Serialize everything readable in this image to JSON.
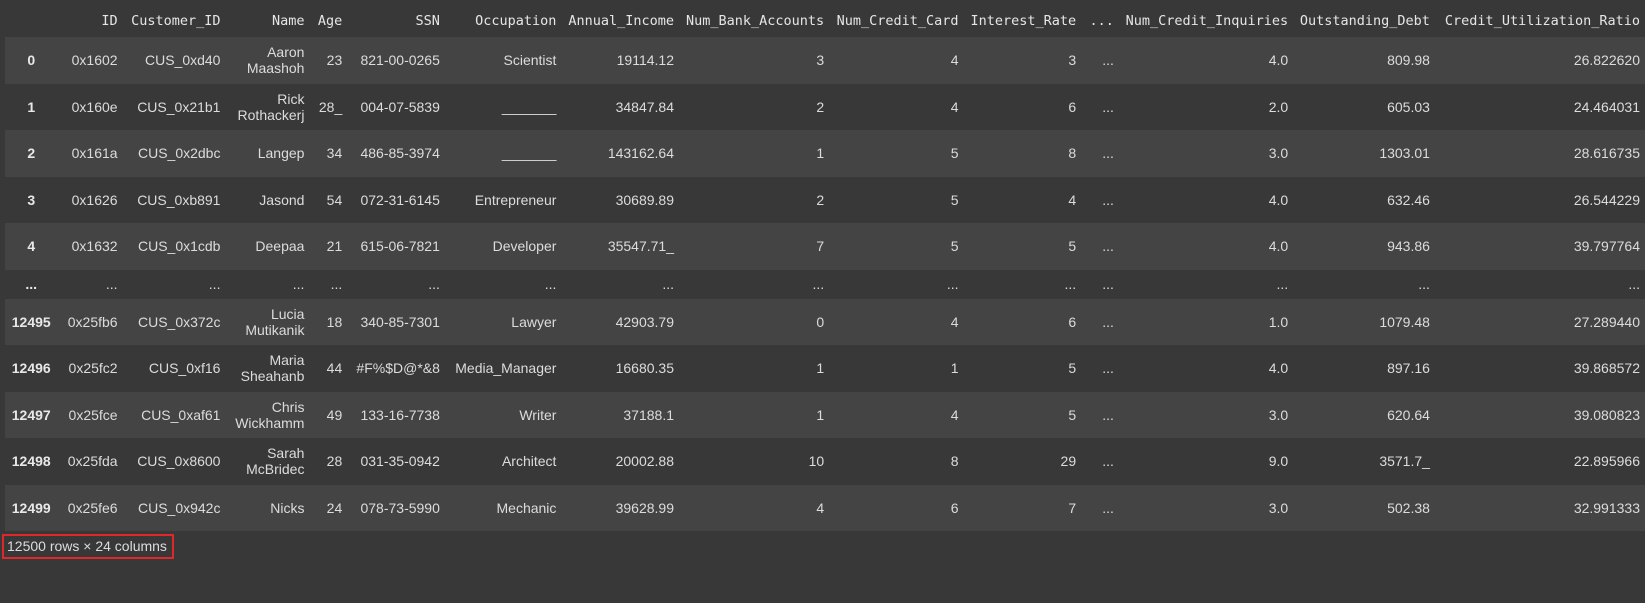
{
  "columns": [
    "",
    "ID",
    "Customer_ID",
    "Name",
    "Age",
    "SSN",
    "Occupation",
    "Annual_Income",
    "Num_Bank_Accounts",
    "Num_Credit_Card",
    "Interest_Rate",
    "...",
    "Num_Credit_Inquiries",
    "Outstanding_Debt",
    "Credit_Utilization_Ratio"
  ],
  "rows": [
    [
      "0",
      "0x1602",
      "CUS_0xd40",
      "Aaron Maashoh",
      "23",
      "821-00-0265",
      "Scientist",
      "19114.12",
      "3",
      "4",
      "3",
      "...",
      "4.0",
      "809.98",
      "26.822620"
    ],
    [
      "1",
      "0x160e",
      "CUS_0x21b1",
      "Rick Rothackerj",
      "28_",
      "004-07-5839",
      "_______",
      "34847.84",
      "2",
      "4",
      "6",
      "...",
      "2.0",
      "605.03",
      "24.464031"
    ],
    [
      "2",
      "0x161a",
      "CUS_0x2dbc",
      "Langep",
      "34",
      "486-85-3974",
      "_______",
      "143162.64",
      "1",
      "5",
      "8",
      "...",
      "3.0",
      "1303.01",
      "28.616735"
    ],
    [
      "3",
      "0x1626",
      "CUS_0xb891",
      "Jasond",
      "54",
      "072-31-6145",
      "Entrepreneur",
      "30689.89",
      "2",
      "5",
      "4",
      "...",
      "4.0",
      "632.46",
      "26.544229"
    ],
    [
      "4",
      "0x1632",
      "CUS_0x1cdb",
      "Deepaa",
      "21",
      "615-06-7821",
      "Developer",
      "35547.71_",
      "7",
      "5",
      "5",
      "...",
      "4.0",
      "943.86",
      "39.797764"
    ],
    [
      "...",
      "...",
      "...",
      "...",
      "...",
      "...",
      "...",
      "...",
      "...",
      "...",
      "...",
      "...",
      "...",
      "...",
      "..."
    ],
    [
      "12495",
      "0x25fb6",
      "CUS_0x372c",
      "Lucia Mutikanik",
      "18",
      "340-85-7301",
      "Lawyer",
      "42903.79",
      "0",
      "4",
      "6",
      "...",
      "1.0",
      "1079.48",
      "27.289440"
    ],
    [
      "12496",
      "0x25fc2",
      "CUS_0xf16",
      "Maria Sheahanb",
      "44",
      "#F%$D@*&8",
      "Media_Manager",
      "16680.35",
      "1",
      "1",
      "5",
      "...",
      "4.0",
      "897.16",
      "39.868572"
    ],
    [
      "12497",
      "0x25fce",
      "CUS_0xaf61",
      "Chris Wickhamm",
      "49",
      "133-16-7738",
      "Writer",
      "37188.1",
      "1",
      "4",
      "5",
      "...",
      "3.0",
      "620.64",
      "39.080823"
    ],
    [
      "12498",
      "0x25fda",
      "CUS_0x8600",
      "Sarah McBridec",
      "28",
      "031-35-0942",
      "Architect",
      "20002.88",
      "10",
      "8",
      "29",
      "...",
      "9.0",
      "3571.7_",
      "22.895966"
    ],
    [
      "12499",
      "0x25fe6",
      "CUS_0x942c",
      "Nicks",
      "24",
      "078-73-5990",
      "Mechanic",
      "39628.99",
      "4",
      "6",
      "7",
      "...",
      "3.0",
      "502.38",
      "32.991333"
    ]
  ],
  "footer": "12500 rows × 24 columns"
}
